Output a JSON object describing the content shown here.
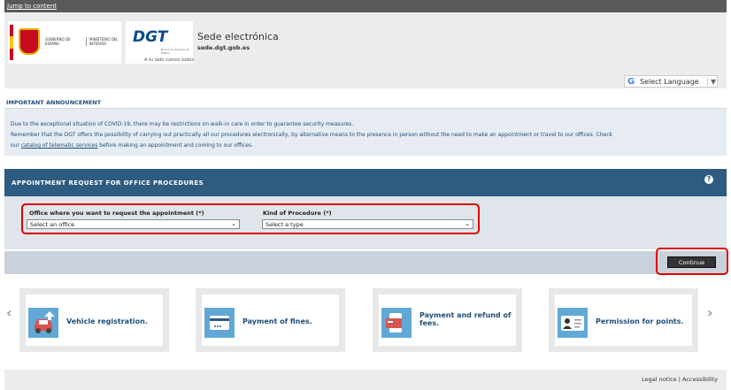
{
  "skip_link": "Jump to content",
  "header": {
    "gov_logo_line1": "GOBIERNO DE ESPAÑA",
    "gov_logo_line2": "MINISTERIO DEL INTERIOR",
    "dgt_logo": "DGT",
    "dgt_logo_sub": "Dirección General de Tráfico",
    "tagline": "A tu lado vamos todos",
    "site_title": "Sede electrónica",
    "site_url": "sede.dgt.gob.es"
  },
  "language": {
    "label": "Select Language",
    "arrow": "▼",
    "google_g": "G"
  },
  "announcement": {
    "title": "IMPORTANT ANNOUNCEMENT",
    "line1": "Due to the exceptional situation of COVID-19, there may be restrictions on walk-in care in order to guarantee security measures.",
    "line2": "Remember that the DGT offers the possibility of carrying out practically all our procedures electronically, by alternative means to the presence in person without the need to make an appointment or travel to our offices. Check",
    "line3_prefix": "our ",
    "line3_link": "catalog of telematic services",
    "line3_suffix": " before making an appointment and coming to our offices."
  },
  "form": {
    "title": "APPOINTMENT REQUEST FOR OFFICE PROCEDURES",
    "help": "?",
    "office_label": "Office where you want to request the appointment (*)",
    "office_value": "Select an office",
    "procedure_label": "Kind of Procedure (*)",
    "procedure_value": "Select a type",
    "chevron": "⌄",
    "continue_label": "Continue"
  },
  "carousel": {
    "prev": "‹",
    "next": "›",
    "cards": [
      {
        "label": "Vehicle registration.",
        "icon": "car-icon"
      },
      {
        "label": "Payment of fines.",
        "icon": "credit-card-icon"
      },
      {
        "label": "Payment and refund of fees.",
        "icon": "card-payment-icon"
      },
      {
        "label": "Permission for points.",
        "icon": "id-card-icon"
      }
    ]
  },
  "footer": {
    "legal": "Legal notice",
    "separator": " | ",
    "accessibility": "Accessibility"
  }
}
